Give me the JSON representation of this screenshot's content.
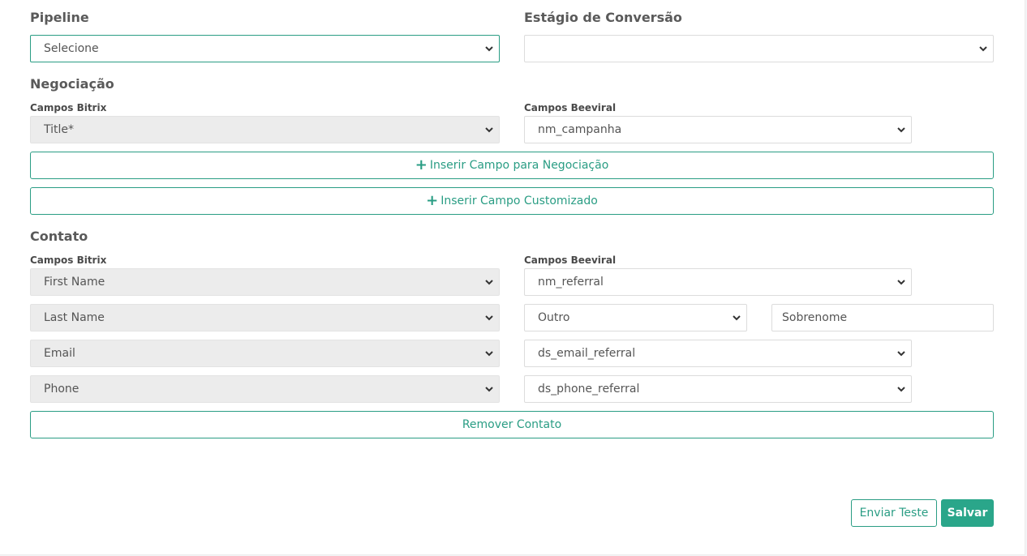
{
  "pipeline": {
    "label": "Pipeline",
    "value": "Selecione"
  },
  "stage": {
    "label": "Estágio de Conversão",
    "value": ""
  },
  "negotiation": {
    "title": "Negociação",
    "bitrix_label": "Campos Bitrix",
    "beeviral_label": "Campos Beeviral",
    "rows": [
      {
        "bitrix": "Title*",
        "beeviral": "nm_campanha"
      }
    ],
    "add_field_button": "Inserir Campo para Negociação",
    "add_custom_button": "Inserir Campo Customizado"
  },
  "contact": {
    "title": "Contato",
    "bitrix_label": "Campos Bitrix",
    "beeviral_label": "Campos Beeviral",
    "rows": [
      {
        "bitrix": "First Name",
        "beeviral": "nm_referral"
      },
      {
        "bitrix": "Last Name",
        "beeviral": "Outro",
        "custom_value": "Sobrenome"
      },
      {
        "bitrix": "Email",
        "beeviral": "ds_email_referral"
      },
      {
        "bitrix": "Phone",
        "beeviral": "ds_phone_referral"
      }
    ],
    "remove_button": "Remover Contato"
  },
  "actions": {
    "test_button": "Enviar Teste",
    "save_button": "Salvar"
  },
  "icons": {
    "plus": "plus-icon",
    "dropdown": "chevron-down-icon"
  },
  "colors": {
    "accent": "#2aa68a",
    "disabled_bg": "#ececec"
  }
}
